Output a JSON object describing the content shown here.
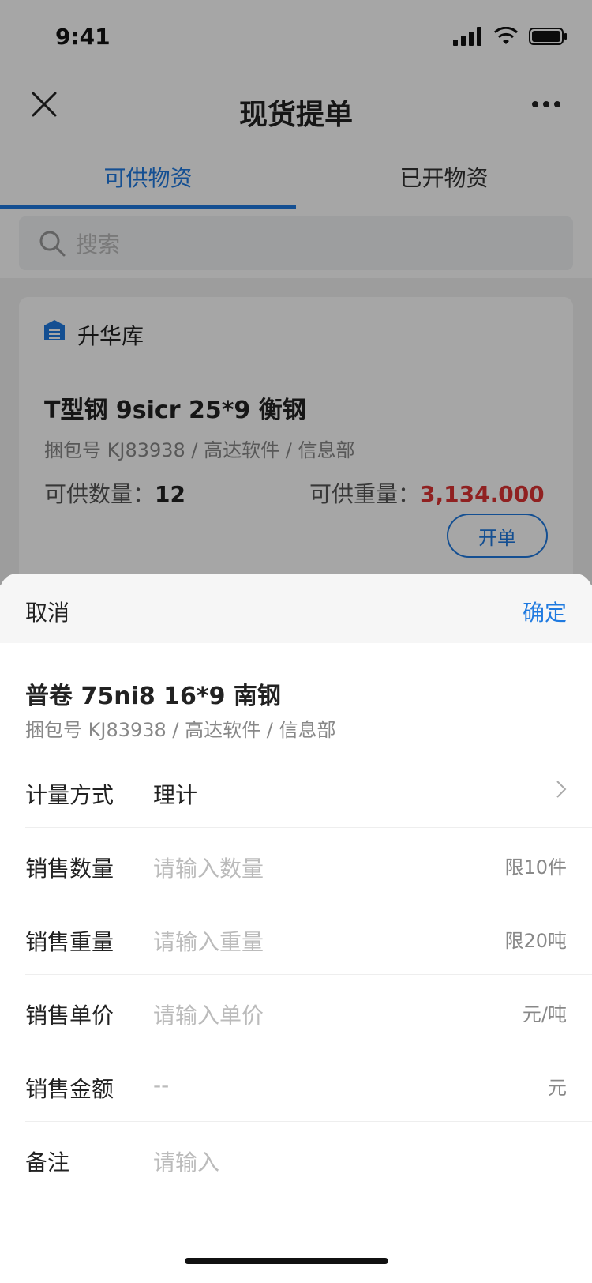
{
  "status": {
    "time": "9:41"
  },
  "nav": {
    "title": "现货提单"
  },
  "tabs": [
    {
      "label": "可供物资",
      "active": true
    },
    {
      "label": "已开物资",
      "active": false
    }
  ],
  "search": {
    "placeholder": "搜索"
  },
  "card": {
    "warehouse": "升华库",
    "item": {
      "title": "T型钢 9sicr 25*9 衡钢",
      "meta": "捆包号 KJ83938  /  高达软件  /  信息部",
      "qty_label": "可供数量：",
      "qty_value": "12",
      "wt_label": "可供重量：",
      "wt_value": "3,134.000",
      "open_btn": "开单"
    }
  },
  "sheet": {
    "cancel": "取消",
    "confirm": "确定",
    "title": "普卷 75ni8 16*9 南钢",
    "meta": "捆包号 KJ83938  /  高达软件  /  信息部",
    "rows": [
      {
        "label": "计量方式",
        "value": "理计",
        "suffix": ""
      },
      {
        "label": "销售数量",
        "placeholder": "请输入数量",
        "suffix": "限10件"
      },
      {
        "label": "销售重量",
        "placeholder": "请输入重量",
        "suffix": "限20吨"
      },
      {
        "label": "销售单价",
        "placeholder": "请输入单价",
        "suffix": "元/吨"
      },
      {
        "label": "销售金额",
        "value": "--",
        "suffix": "元"
      },
      {
        "label": "备注",
        "placeholder": "请输入",
        "suffix": ""
      }
    ]
  },
  "colors": {
    "accent": "#1f7ae0",
    "danger": "#d33"
  }
}
